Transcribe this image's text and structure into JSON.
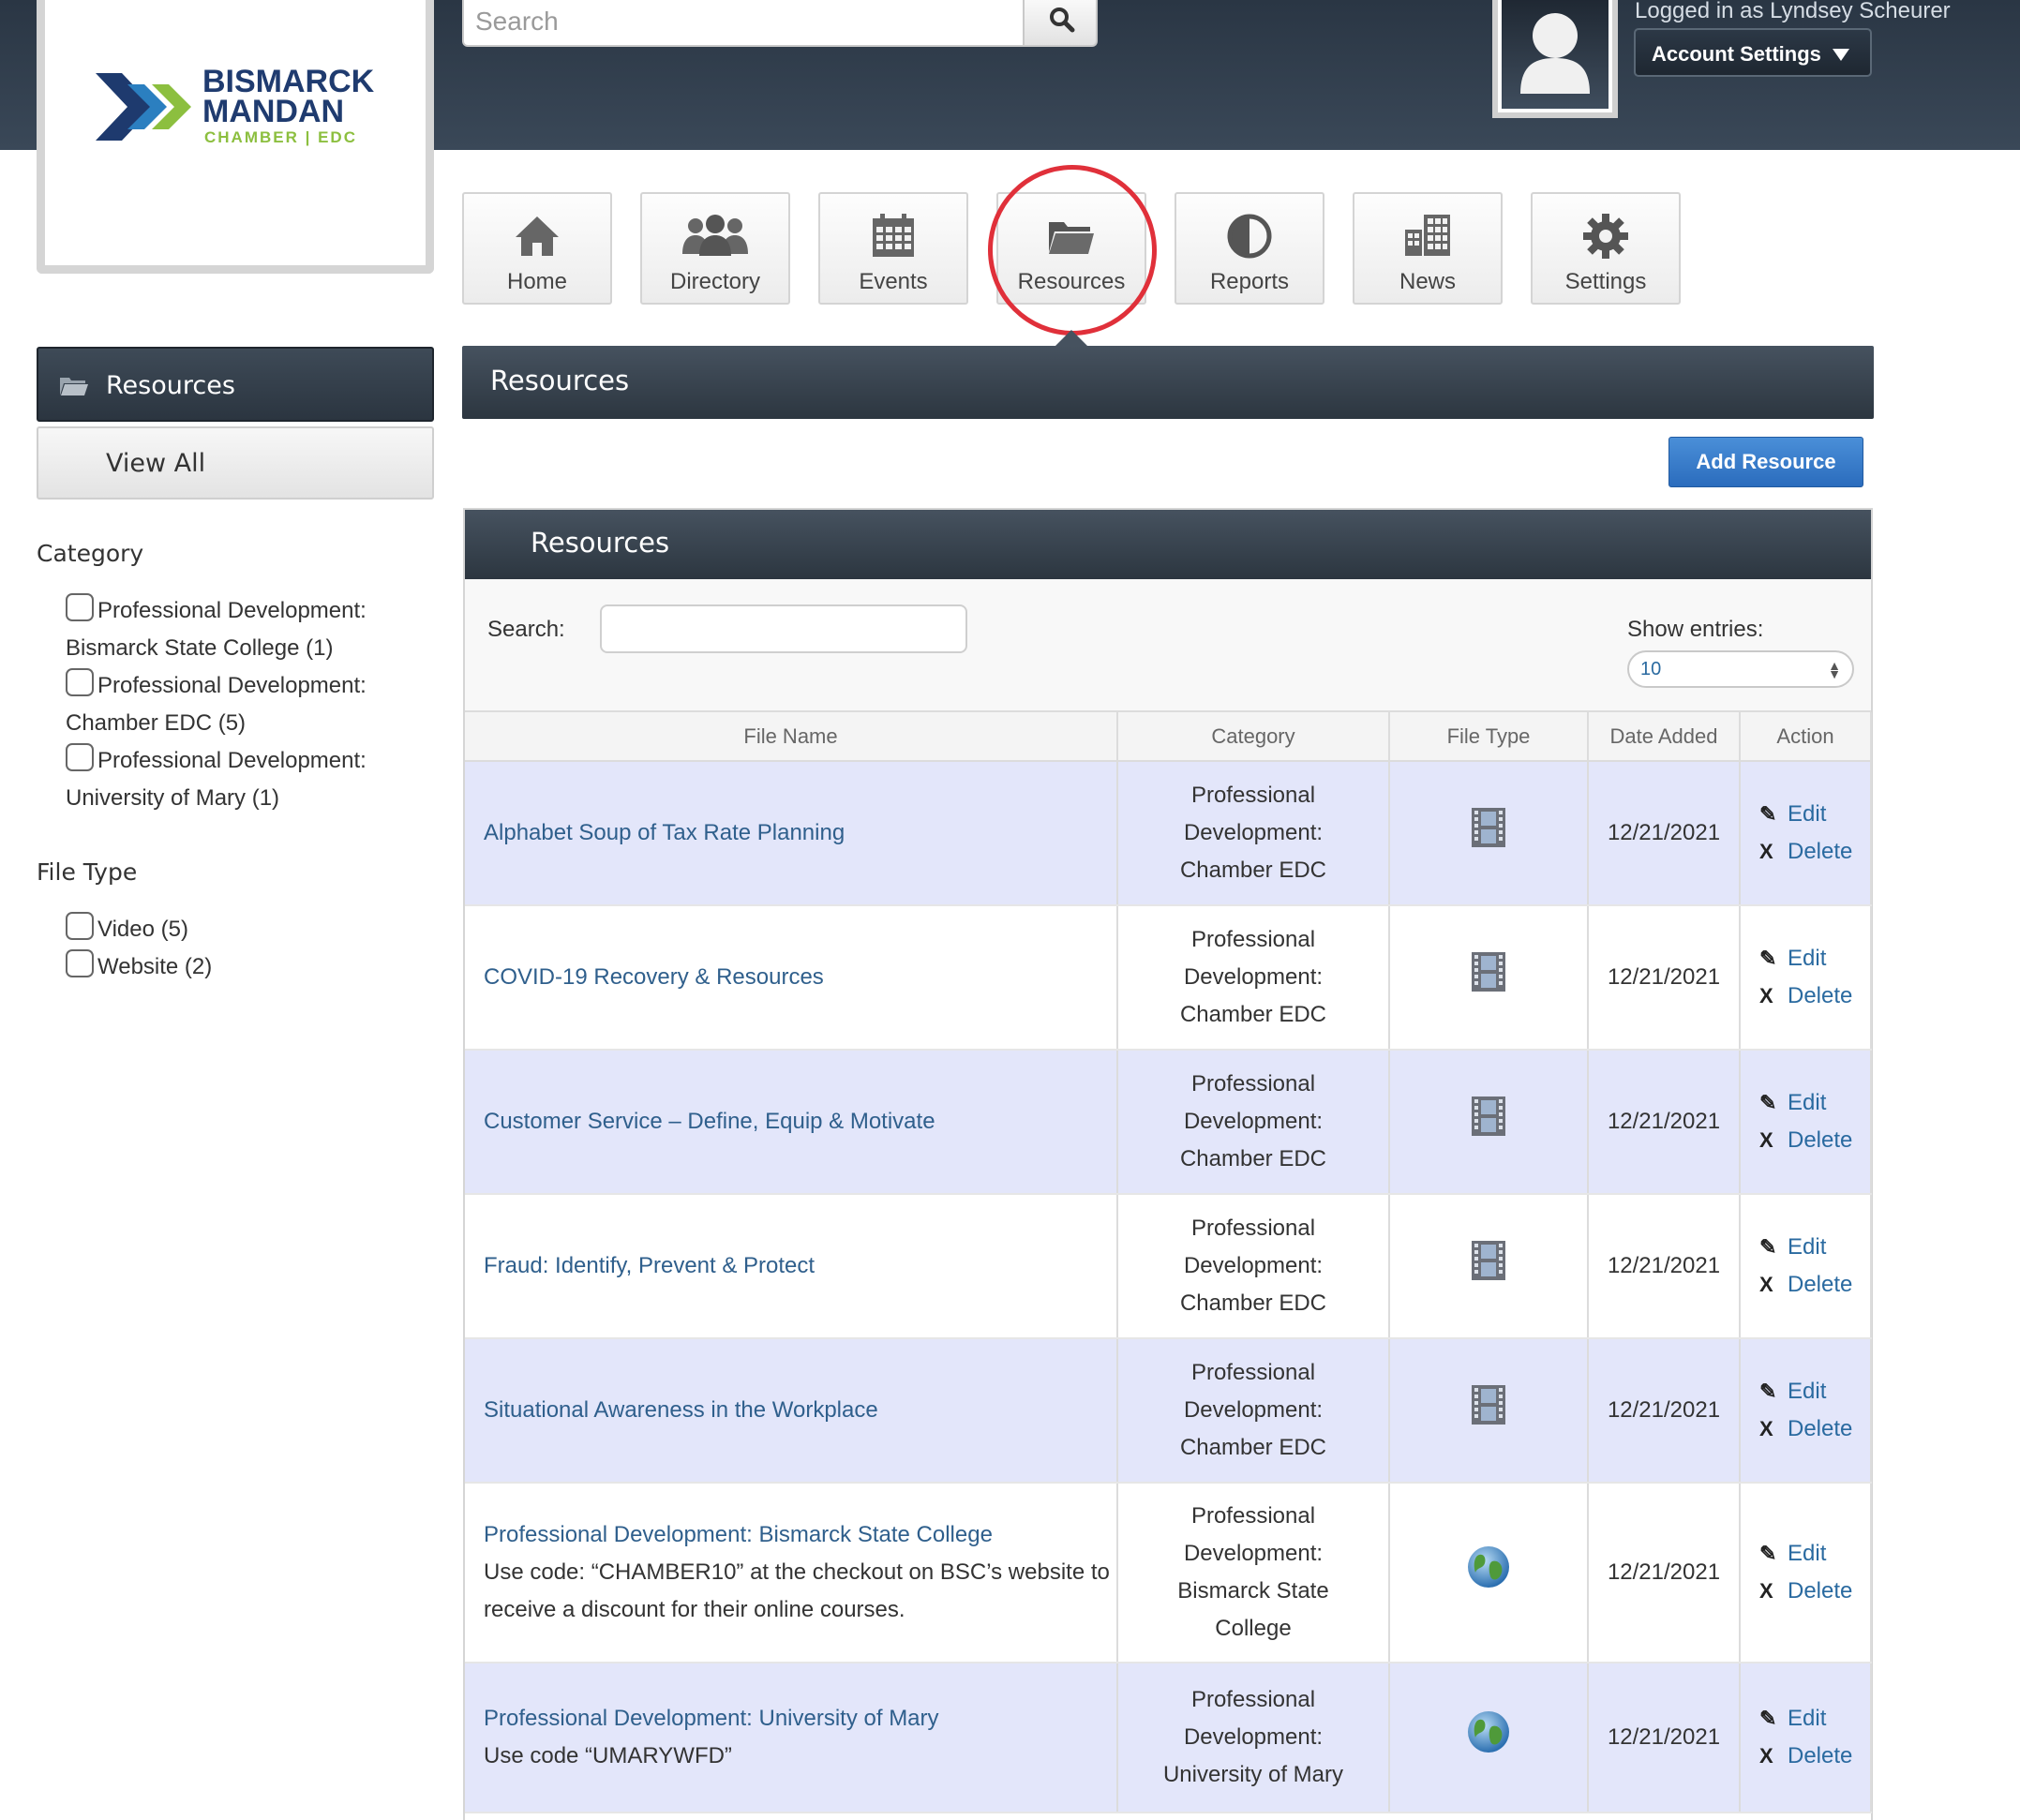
{
  "header": {
    "logo": {
      "line1": "BISMARCK",
      "line2": "MANDAN",
      "line3": "CHAMBER | EDC"
    },
    "search": {
      "placeholder": "Search"
    },
    "user": {
      "logged_in_text": "Logged in as Lyndsey Scheurer",
      "account_button": "Account Settings"
    }
  },
  "nav": {
    "items": [
      {
        "label": "Home",
        "icon": "home-icon"
      },
      {
        "label": "Directory",
        "icon": "people-icon"
      },
      {
        "label": "Events",
        "icon": "calendar-icon"
      },
      {
        "label": "Resources",
        "icon": "folder-icon",
        "active": true
      },
      {
        "label": "Reports",
        "icon": "pie-chart-icon"
      },
      {
        "label": "News",
        "icon": "buildings-icon"
      },
      {
        "label": "Settings",
        "icon": "gear-icon"
      }
    ]
  },
  "sidebar": {
    "active_item": "Resources",
    "view_all": "View All",
    "category_heading": "Category",
    "categories": [
      {
        "line1": "Professional Development:",
        "line2": "Bismarck State College (1)"
      },
      {
        "line1": "Professional Development:",
        "line2": "Chamber EDC (5)"
      },
      {
        "line1": "Professional Development:",
        "line2": "University of Mary (1)"
      }
    ],
    "filetype_heading": "File Type",
    "filetypes": [
      "Video (5)",
      "Website (2)"
    ]
  },
  "main": {
    "title": "Resources",
    "add_button": "Add Resource",
    "panel_title": "Resources",
    "search_label": "Search:",
    "show_entries_label": "Show entries:",
    "show_entries_value": "10",
    "columns": [
      "File Name",
      "Category",
      "File Type",
      "Date Added",
      "Action"
    ],
    "rows": [
      {
        "name": "Alphabet Soup of Tax Rate Planning",
        "desc": "",
        "category": [
          "Professional",
          "Development:",
          "Chamber EDC"
        ],
        "type": "film-icon",
        "date": "12/21/2021"
      },
      {
        "name": "COVID-19 Recovery & Resources",
        "desc": "",
        "category": [
          "Professional",
          "Development:",
          "Chamber EDC"
        ],
        "type": "film-icon",
        "date": "12/21/2021"
      },
      {
        "name": "Customer Service – Define, Equip & Motivate",
        "desc": "",
        "category": [
          "Professional",
          "Development:",
          "Chamber EDC"
        ],
        "type": "film-icon",
        "date": "12/21/2021"
      },
      {
        "name": "Fraud: Identify, Prevent & Protect",
        "desc": "",
        "category": [
          "Professional",
          "Development:",
          "Chamber EDC"
        ],
        "type": "film-icon",
        "date": "12/21/2021"
      },
      {
        "name": "Situational Awareness in the Workplace",
        "desc": "",
        "category": [
          "Professional",
          "Development:",
          "Chamber EDC"
        ],
        "type": "film-icon",
        "date": "12/21/2021"
      },
      {
        "name": "Professional Development: Bismarck State College",
        "desc": "Use code: “CHAMBER10” at the checkout on BSC’s website to receive a discount for their online courses.",
        "category": [
          "Professional",
          "Development:",
          "Bismarck State",
          "College"
        ],
        "type": "globe-icon",
        "date": "12/21/2021"
      },
      {
        "name": "Professional Development: University of Mary",
        "desc": "Use code “UMARYWFD”",
        "category": [
          "Professional",
          "Development:",
          "University of Mary"
        ],
        "type": "globe-icon",
        "date": "12/21/2021"
      }
    ],
    "action_edit": "Edit",
    "action_delete": "Delete",
    "delete_glyph": "X"
  }
}
